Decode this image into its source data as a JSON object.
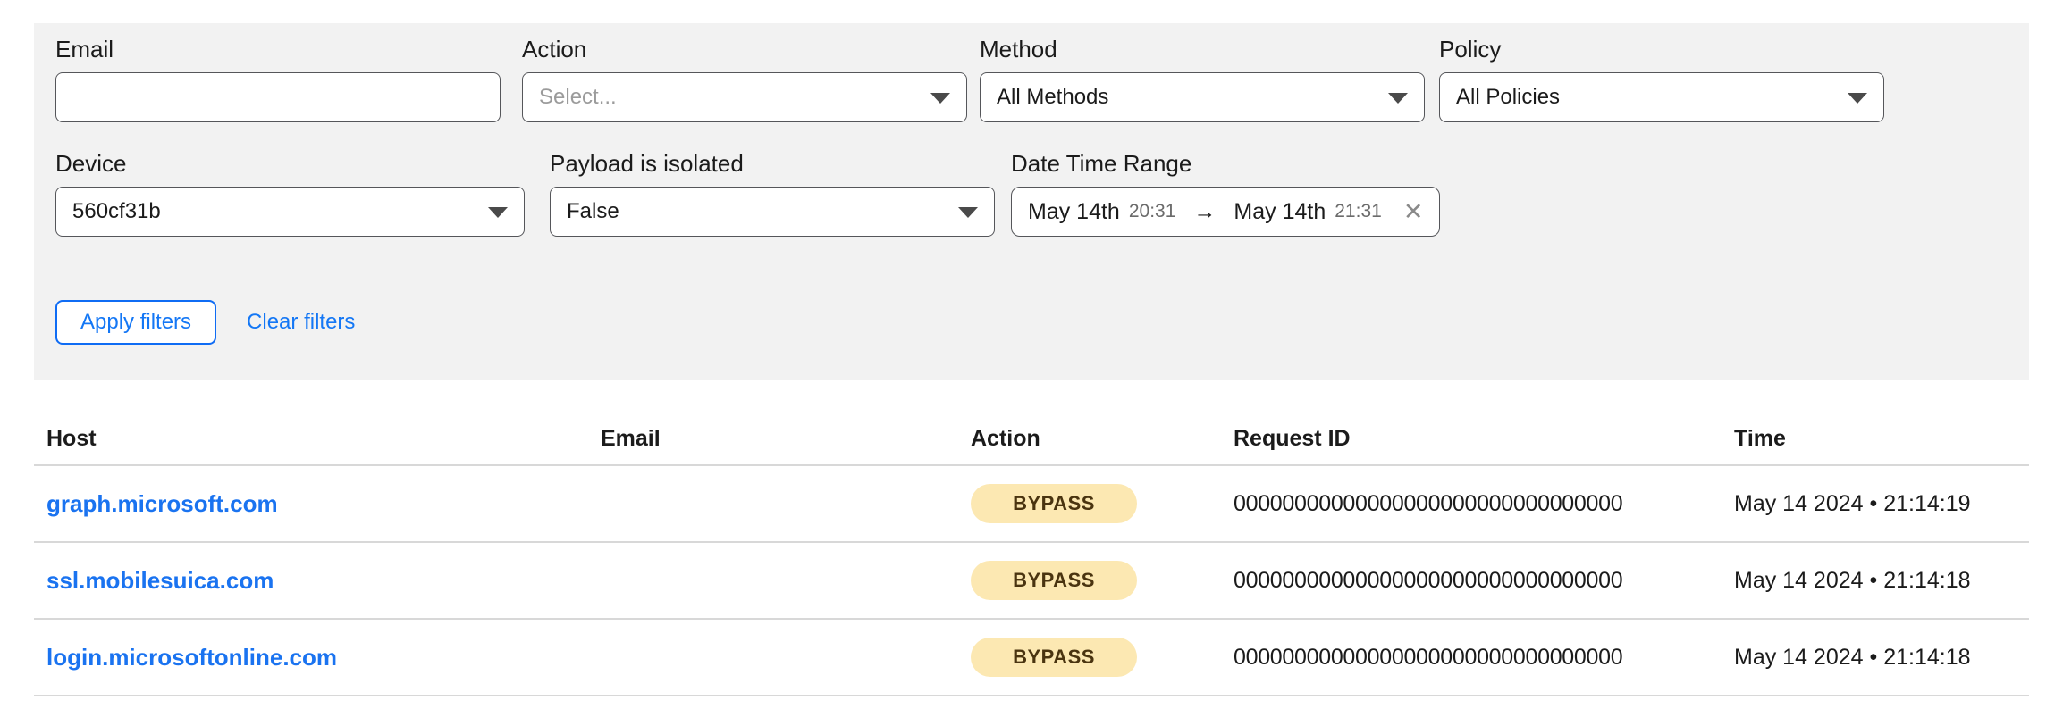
{
  "filters": {
    "email": {
      "label": "Email",
      "value": "",
      "placeholder": ""
    },
    "action": {
      "label": "Action",
      "value": "",
      "placeholder": "Select..."
    },
    "method": {
      "label": "Method",
      "value": "All Methods"
    },
    "policy": {
      "label": "Policy",
      "value": "All Policies"
    },
    "device": {
      "label": "Device",
      "value": "560cf31b"
    },
    "payload_isolated": {
      "label": "Payload is isolated",
      "value": "False"
    },
    "date_time_range": {
      "label": "Date Time Range",
      "start_date": "May 14th",
      "start_time": "20:31",
      "arrow": "→",
      "end_date": "May 14th",
      "end_time": "21:31",
      "clear_icon": "✕"
    },
    "apply_label": "Apply filters",
    "clear_label": "Clear filters"
  },
  "table": {
    "columns": [
      "Host",
      "Email",
      "Action",
      "Request ID",
      "Time"
    ],
    "rows": [
      {
        "host": "graph.microsoft.com",
        "email": "",
        "action": "BYPASS",
        "request_id": "00000000000000000000000000000000",
        "time": "May 14 2024 • 21:14:19"
      },
      {
        "host": "ssl.mobilesuica.com",
        "email": "",
        "action": "BYPASS",
        "request_id": "00000000000000000000000000000000",
        "time": "May 14 2024 • 21:14:18"
      },
      {
        "host": "login.microsoftonline.com",
        "email": "",
        "action": "BYPASS",
        "request_id": "00000000000000000000000000000000",
        "time": "May 14 2024 • 21:14:18"
      }
    ]
  },
  "colors": {
    "panel_bg": "#f2f2f2",
    "link": "#1a73f0",
    "accent": "#1477f5",
    "badge_bg": "#fce8b2",
    "badge_text": "#4a3410",
    "border": "#55565a"
  }
}
